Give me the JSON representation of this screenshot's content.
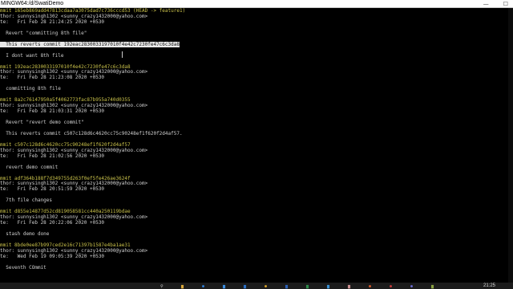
{
  "window": {
    "title": "MINGW64:/d/SwatiDemo",
    "minimize": "—",
    "maximize": "☐"
  },
  "log": [
    {
      "text": "mmit 165eb869add47813cdaa7a3075dad7c736cccd53 (HEAD -> feature1)",
      "color": "yellow"
    },
    {
      "text": "thor: sunnysingh1302 <sunny_crazy1432000@yahoo.com>"
    },
    {
      "text": "te:   Fri Feb 28 21:24:25 2020 +0530"
    },
    {
      "text": ""
    },
    {
      "text": "  Revert \"committing 8th file\""
    },
    {
      "text": ""
    },
    {
      "text": "  This reverts commit 192eac2830033197010f4e42c7230fe47c6c3da8",
      "selected": true
    },
    {
      "text": ""
    },
    {
      "text": "  I dont want 8th file"
    },
    {
      "text": ""
    },
    {
      "text": "mmit 192eac2830033197010f4e42c7230fe47c6c3da8",
      "color": "yellow"
    },
    {
      "text": "thor: sunnysingh1302 <sunny_crazy1432000@yahoo.com>"
    },
    {
      "text": "te:   Fri Feb 28 21:23:08 2020 +0530"
    },
    {
      "text": ""
    },
    {
      "text": "  committing 8th file"
    },
    {
      "text": ""
    },
    {
      "text": "mmit 8a2c76147950a5f4062773fac87b955a740d0355",
      "color": "yellow"
    },
    {
      "text": "thor: sunnysingh1302 <sunny_crazy1432000@yahoo.com>"
    },
    {
      "text": "te:   Fri Feb 28 21:03:31 2020 +0530"
    },
    {
      "text": ""
    },
    {
      "text": "  Revert \"revert demo commit\""
    },
    {
      "text": ""
    },
    {
      "text": "  This reverts commit c507c128d6c4620cc75c90248ef1f620f2d4af57."
    },
    {
      "text": ""
    },
    {
      "text": "mmit c507c128d6c4620cc75c90248ef1f620f2d4af57",
      "color": "yellow"
    },
    {
      "text": "thor: sunnysingh1302 <sunny_crazy1432000@yahoo.com>"
    },
    {
      "text": "te:   Fri Feb 28 21:02:56 2020 +0530"
    },
    {
      "text": ""
    },
    {
      "text": "  revert demo commit"
    },
    {
      "text": ""
    },
    {
      "text": "mmit adf364b188f7d349755d263f0ef5fe426ae3624f",
      "color": "yellow"
    },
    {
      "text": "thor: sunnysingh1302 <sunny_crazy1432000@yahoo.com>"
    },
    {
      "text": "te:   Fri Feb 28 20:51:59 2020 +0530"
    },
    {
      "text": ""
    },
    {
      "text": "  7th file changes"
    },
    {
      "text": ""
    },
    {
      "text": "mmit d855e14877d52cd819058581cc440a250119bdae",
      "color": "yellow"
    },
    {
      "text": "thor: sunnysingh1302 <sunny_crazy1432000@yahoo.com>"
    },
    {
      "text": "te:   Fri Feb 28 20:22:06 2020 +0530"
    },
    {
      "text": ""
    },
    {
      "text": "  stash demo done"
    },
    {
      "text": ""
    },
    {
      "text": "mmit 8bde0ee87b997ced2e16c71397b1587e4ba1ae31",
      "color": "yellow"
    },
    {
      "text": "thor: sunnysingh1302 <sunny_crazy1432000@yahoo.com>"
    },
    {
      "text": "te:   Wed Feb 19 09:05:39 2020 +0530"
    },
    {
      "text": ""
    },
    {
      "text": "  Seventh COmmit"
    }
  ],
  "taskbar": {
    "icons": [
      {
        "name": "search-icon",
        "glyph": "⚲",
        "color": "#cfcfcf"
      },
      {
        "name": "folder-icon",
        "glyph": "▆",
        "color": "#d9a73a"
      },
      {
        "name": "edge-icon",
        "glyph": "●",
        "color": "#2f7fd6"
      },
      {
        "name": "store-icon",
        "glyph": "▆",
        "color": "#3b8de0"
      },
      {
        "name": "mail-icon",
        "glyph": "▆",
        "color": "#2a6fc4"
      },
      {
        "name": "chrome-icon",
        "glyph": "●",
        "color": "#d6a12a"
      },
      {
        "name": "word-icon",
        "glyph": "▆",
        "color": "#2b5fb5"
      },
      {
        "name": "excel-icon",
        "glyph": "▆",
        "color": "#2e8a4a"
      },
      {
        "name": "vscode-icon",
        "glyph": "▆",
        "color": "#3a8fd0"
      },
      {
        "name": "gitbash-icon",
        "glyph": "▆",
        "color": "#c98f8f"
      },
      {
        "name": "firefox-icon",
        "glyph": "●",
        "color": "#d85a2a"
      },
      {
        "name": "app-icon",
        "glyph": "●",
        "color": "#c83a3a"
      },
      {
        "name": "app2-icon",
        "glyph": "●",
        "color": "#6a6ad0"
      },
      {
        "name": "app3-icon",
        "glyph": "▆",
        "color": "#8aa040"
      }
    ],
    "clock": "21:25"
  }
}
